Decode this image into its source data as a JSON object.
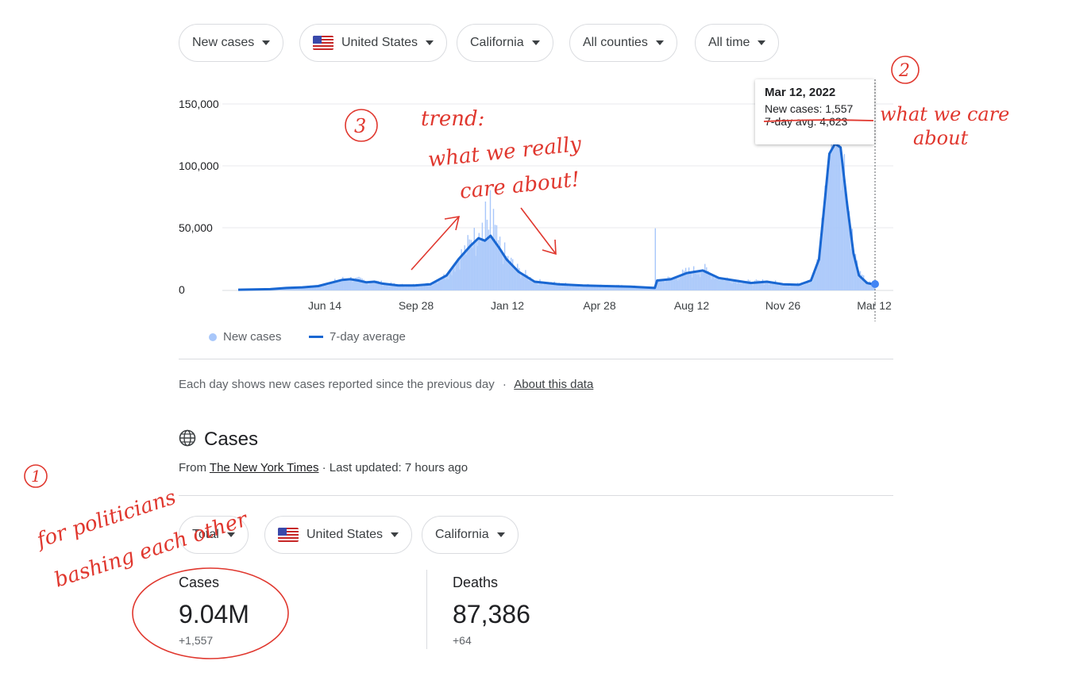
{
  "filters": {
    "metric": "New cases",
    "country": "United States",
    "state": "California",
    "county": "All counties",
    "range": "All time"
  },
  "chart_data": {
    "type": "bar",
    "y_ticks": [
      "150,000",
      "100,000",
      "50,000",
      "0"
    ],
    "x_ticks": [
      "Jun 14",
      "Sep 28",
      "Jan 12",
      "Apr 28",
      "Aug 12",
      "Nov 26",
      "Mar 12"
    ],
    "ylim": [
      0,
      150000
    ],
    "series": [
      {
        "name": "New cases",
        "color": "#a8c7fa"
      },
      {
        "name": "7-day average",
        "color": "#1967d2",
        "values": [
          [
            0,
            600
          ],
          [
            40,
            1000
          ],
          [
            60,
            2000
          ],
          [
            80,
            2500
          ],
          [
            100,
            3500
          ],
          [
            115,
            6000
          ],
          [
            130,
            8500
          ],
          [
            140,
            9000
          ],
          [
            150,
            8000
          ],
          [
            160,
            6500
          ],
          [
            170,
            7000
          ],
          [
            180,
            5500
          ],
          [
            200,
            4000
          ],
          [
            220,
            4000
          ],
          [
            240,
            5000
          ],
          [
            260,
            12000
          ],
          [
            275,
            25000
          ],
          [
            290,
            36000
          ],
          [
            300,
            42000
          ],
          [
            308,
            40000
          ],
          [
            315,
            44000
          ],
          [
            325,
            35000
          ],
          [
            335,
            25000
          ],
          [
            350,
            15000
          ],
          [
            370,
            7000
          ],
          [
            400,
            5000
          ],
          [
            430,
            4000
          ],
          [
            460,
            3500
          ],
          [
            490,
            3000
          ],
          [
            520,
            2000
          ],
          [
            523,
            8000
          ],
          [
            540,
            9000
          ],
          [
            560,
            14000
          ],
          [
            580,
            16000
          ],
          [
            600,
            10000
          ],
          [
            620,
            8000
          ],
          [
            640,
            6000
          ],
          [
            660,
            7000
          ],
          [
            680,
            5000
          ],
          [
            700,
            4500
          ],
          [
            715,
            8000
          ],
          [
            725,
            25000
          ],
          [
            732,
            70000
          ],
          [
            738,
            110000
          ],
          [
            745,
            118000
          ],
          [
            752,
            115000
          ],
          [
            760,
            70000
          ],
          [
            768,
            30000
          ],
          [
            775,
            12000
          ],
          [
            785,
            6000
          ],
          [
            795,
            4623
          ]
        ]
      }
    ],
    "tooltip": {
      "date": "Mar 12, 2022",
      "new_cases": "New cases: 1,557",
      "avg": "7-day avg: 4,623"
    }
  },
  "legend": {
    "bars": "New cases",
    "line": "7-day average"
  },
  "note": {
    "text": "Each day shows new cases reported since the previous day",
    "sep": "·",
    "link": "About this data"
  },
  "cases_section": {
    "title": "Cases",
    "source_prefix": "From",
    "source": "The New York Times",
    "updated": "· Last updated: 7 hours ago",
    "chips": {
      "total": "Total",
      "country": "United States",
      "state": "California"
    },
    "stats": [
      {
        "label": "Cases",
        "value": "9.04M",
        "delta": "+1,557"
      },
      {
        "label": "Deaths",
        "value": "87,386",
        "delta": "+64"
      }
    ]
  },
  "annotations": {
    "n1": "1",
    "n2": "2",
    "n3": "3",
    "trend1": "trend:",
    "trend2": "what we really",
    "trend3": "care about!",
    "care1": "what we care",
    "care2": "about",
    "pol1": "for politicians",
    "pol2": "bashing each other"
  }
}
